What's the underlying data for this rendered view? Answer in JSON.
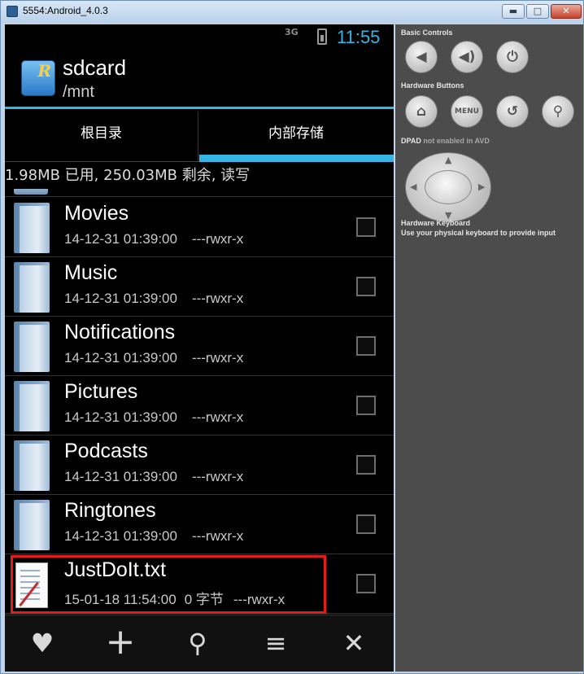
{
  "window": {
    "title": "5554:Android_4.0.3",
    "minimize": "▬",
    "maximize": "□",
    "close": "✕"
  },
  "status": {
    "network": "3G",
    "time": "11:55"
  },
  "actionbar": {
    "title": "sdcard",
    "subtitle": "/mnt",
    "logo_letter": "R"
  },
  "tabs": [
    {
      "label": "根目录"
    },
    {
      "label": "内部存储"
    }
  ],
  "storage_info": "1.98MB 已用, 250.03MB 剩余, 读写",
  "files": [
    {
      "name": "Movies",
      "date": "14-12-31 01:39:00",
      "perm": "---rwxr-x",
      "type": "folder"
    },
    {
      "name": "Music",
      "date": "14-12-31 01:39:00",
      "perm": "---rwxr-x",
      "type": "folder"
    },
    {
      "name": "Notifications",
      "date": "14-12-31 01:39:00",
      "perm": "---rwxr-x",
      "type": "folder"
    },
    {
      "name": "Pictures",
      "date": "14-12-31 01:39:00",
      "perm": "---rwxr-x",
      "type": "folder"
    },
    {
      "name": "Podcasts",
      "date": "14-12-31 01:39:00",
      "perm": "---rwxr-x",
      "type": "folder"
    },
    {
      "name": "Ringtones",
      "date": "14-12-31 01:39:00",
      "perm": "---rwxr-x",
      "type": "folder"
    },
    {
      "name": "JustDoIt.txt",
      "date": "15-01-18 11:54:00",
      "size": "0 字节",
      "perm": "---rwxr-x",
      "type": "file"
    }
  ],
  "bottombar": {
    "favorite": "♥",
    "add": "+",
    "search": "⚲",
    "sort": "≡",
    "close": "✕"
  },
  "controls": {
    "basic_label": "Basic Controls",
    "hardware_label": "Hardware Buttons",
    "dpad_label": "DPAD",
    "dpad_note": "not enabled in AVD",
    "keyboard_label": "Hardware Keyboard",
    "keyboard_note": "Use your physical keyboard to provide input",
    "menu": "MENU",
    "volume_down": "◀",
    "volume_up": "◀)",
    "power": "⏻",
    "home": "⌂",
    "back": "↺",
    "search": "⚲"
  }
}
